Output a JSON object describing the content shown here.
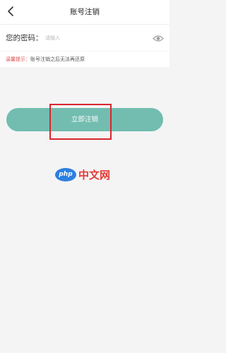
{
  "header": {
    "title": "账号注销",
    "back_icon": "chevron-left-icon"
  },
  "password": {
    "label": "您的密码：",
    "placeholder": "请输入",
    "value": "",
    "toggle_icon": "eye-icon"
  },
  "tip": {
    "label": "温馨提示：",
    "text": "账号注销之后无法再还原"
  },
  "action": {
    "button_label": "立即注销"
  },
  "watermark": {
    "brand": "php",
    "text": "中文网"
  },
  "colors": {
    "accent": "#72bdb0",
    "warning": "#d9534f",
    "highlight": "#d8262f"
  }
}
